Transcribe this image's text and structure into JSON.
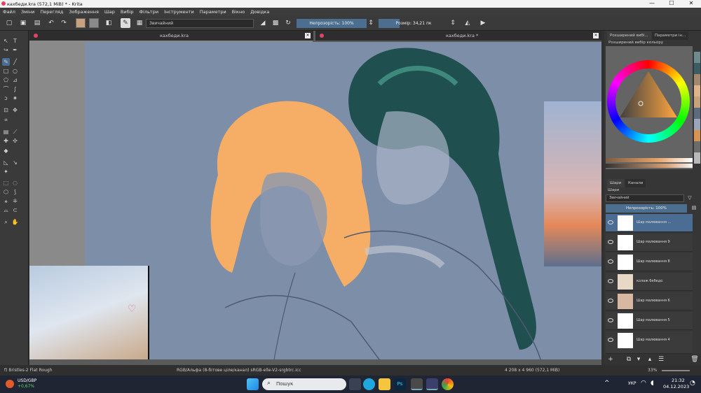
{
  "window": {
    "title": "кахбеди.kra (572,1 MiB)  * - Krita",
    "minimize": "—",
    "maximize": "☐",
    "close": "✕"
  },
  "menu": [
    "Файл",
    "Зміни",
    "Перегляд",
    "Зображення",
    "Шар",
    "Вибір",
    "Фільтри",
    "Інструменти",
    "Параметри",
    "Вікно",
    "Довідка"
  ],
  "toolbar": {
    "brush_mode": "Звичайний",
    "opacity": "Непрозорість: 100%",
    "size": "Розмір: 34,21 пк"
  },
  "canvas": {
    "tab1": "кахбеди.kra",
    "tab2": "кахбеди.kra *",
    "close_glyph": "✕"
  },
  "dock": {
    "tab_advanced": "Розширений вибі...",
    "tab_params": "Параметри ін...",
    "panel_title": "Розширений вибір кольору",
    "layers_tab": "Шари",
    "channels_tab": "Канали",
    "layers_title": "Шари",
    "blend_mode": "Звичайний",
    "opacity": "Непрозорість:  100%",
    "layers": [
      {
        "name": "Шар малювання ..."
      },
      {
        "name": "Шар малювання 9"
      },
      {
        "name": "Шар малювання 8"
      },
      {
        "name": "колаж бебедо"
      },
      {
        "name": "Шар малювання 6"
      },
      {
        "name": "Шар малювання 5"
      },
      {
        "name": "Шар малювання 4"
      }
    ]
  },
  "status": {
    "brush": "f) Bristles-2 Flat Rough",
    "color_space": "RGB/Альфа (8-бітове ціле/канал)  sRGB-elle-V2-srgbtrc.icc",
    "dimensions": "4 208 x 4 960 (572,1 MiB)",
    "zoom": "33%"
  },
  "taskbar": {
    "ticker": "USD/GBP",
    "change": "+0,67%",
    "search": "Пошук",
    "lang": "УКР",
    "time": "21:32",
    "date": "04.12.2023"
  },
  "colors": {
    "accent": "#4b6d93",
    "canvas_bg": "#7d8ea8",
    "hair_orange": "#f6ad66",
    "hair_teal": "#1f4f4f"
  }
}
